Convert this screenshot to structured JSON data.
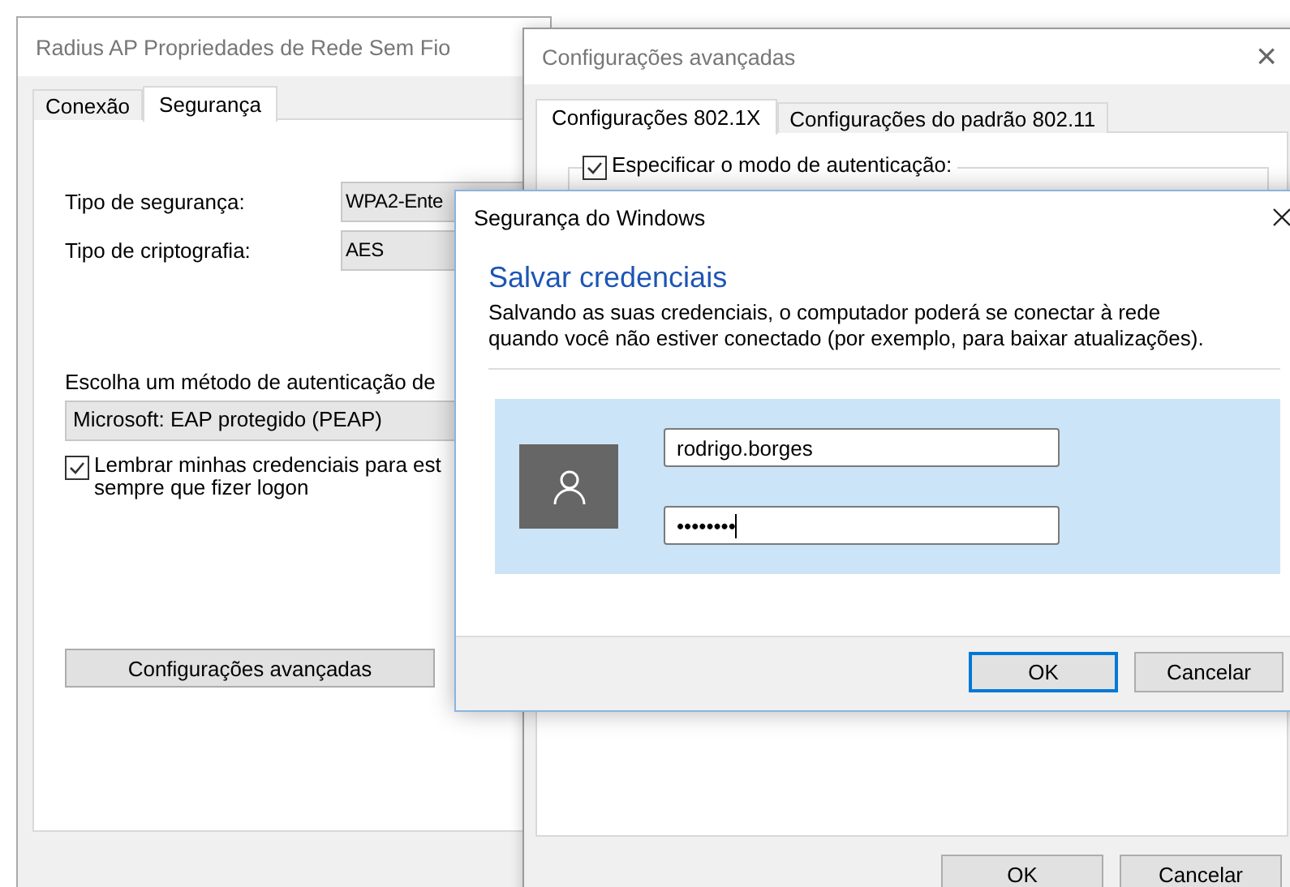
{
  "properties_window": {
    "title": "Radius AP Propriedades de Rede Sem Fio",
    "tabs": [
      {
        "label": "Conexão",
        "selected": false
      },
      {
        "label": "Segurança",
        "selected": true
      }
    ],
    "security_type": {
      "label": "Tipo de segurança:",
      "value": "WPA2-Ente"
    },
    "encryption_type": {
      "label": "Tipo de criptografia:",
      "value": "AES"
    },
    "auth_method": {
      "label": "Escolha um método de autenticação de",
      "value": "Microsoft: EAP protegido (PEAP)"
    },
    "remember_credentials": {
      "label": "Lembrar minhas credenciais para est",
      "label_line_2": "sempre que fizer logon",
      "checked": true
    },
    "advanced_button": "Configurações avançadas"
  },
  "advanced_window": {
    "title": "Configurações avançadas",
    "close": "×",
    "tabs": [
      {
        "label": "Configurações 802.1X",
        "selected": true
      },
      {
        "label": "Configurações do padrão 802.11",
        "selected": false
      }
    ],
    "specify_mode": {
      "label": "Especificar o modo de autenticação:",
      "checked": true
    },
    "buttons": [
      "OK",
      "Cancelar"
    ]
  },
  "credentials_dialog": {
    "title": "Segurança do Windows",
    "heading": "Salvar credenciais",
    "message": "Salvando as suas credenciais, o computador poderá se conectar à rede quando você não estiver conectado (por exemplo, para baixar atualizações).",
    "username": "rodrigo.borges",
    "password": "••••••••",
    "buttons": [
      {
        "label": "OK",
        "focused": true
      },
      {
        "label": "Cancelar",
        "focused": false
      }
    ]
  }
}
